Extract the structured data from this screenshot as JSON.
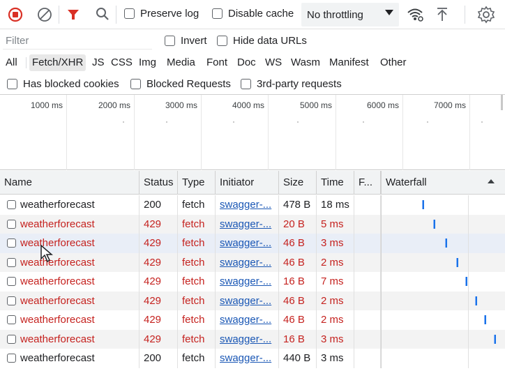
{
  "toolbar": {
    "record_icon": "record-stop-icon",
    "clear_icon": "clear-icon",
    "filter_icon": "filter-funnel-icon",
    "search_icon": "search-icon",
    "preserve_log_label": "Preserve log",
    "disable_cache_label": "Disable cache",
    "throttling_value": "No throttling",
    "colors": {
      "record": "#d93025",
      "filter": "#d93025",
      "error": "#c5221f",
      "link": "#1a57b5",
      "waterfall_bar": "#1a73e8"
    }
  },
  "filter": {
    "placeholder": "Filter",
    "invert_label": "Invert",
    "hide_data_urls_label": "Hide data URLs"
  },
  "types": [
    "All",
    "Fetch/XHR",
    "JS",
    "CSS",
    "Img",
    "Media",
    "Font",
    "Doc",
    "WS",
    "Wasm",
    "Manifest",
    "Other"
  ],
  "active_type": "Fetch/XHR",
  "blocked": {
    "has_blocked_cookies_label": "Has blocked cookies",
    "blocked_requests_label": "Blocked Requests",
    "third_party_label": "3rd-party requests"
  },
  "overview": {
    "ticks": [
      "1000 ms",
      "2000 ms",
      "3000 ms",
      "4000 ms",
      "5000 ms",
      "6000 ms",
      "7000 ms"
    ]
  },
  "table": {
    "columns": {
      "name": "Name",
      "status": "Status",
      "type": "Type",
      "initiator": "Initiator",
      "size": "Size",
      "time": "Time",
      "fulfilled": "F...",
      "waterfall": "Waterfall"
    },
    "rows": [
      {
        "name": "weatherforecast",
        "status": "200",
        "type": "fetch",
        "initiator": "swagger-...",
        "size": "478 B",
        "time": "18 ms",
        "error": false,
        "wf": 0.4
      },
      {
        "name": "weatherforecast",
        "status": "429",
        "type": "fetch",
        "initiator": "swagger-...",
        "size": "20 B",
        "time": "5 ms",
        "error": true,
        "wf": 0.51
      },
      {
        "name": "weatherforecast",
        "status": "429",
        "type": "fetch",
        "initiator": "swagger-...",
        "size": "46 B",
        "time": "3 ms",
        "error": true,
        "wf": 0.62
      },
      {
        "name": "weatherforecast",
        "status": "429",
        "type": "fetch",
        "initiator": "swagger-...",
        "size": "46 B",
        "time": "2 ms",
        "error": true,
        "wf": 0.73
      },
      {
        "name": "weatherforecast",
        "status": "429",
        "type": "fetch",
        "initiator": "swagger-...",
        "size": "16 B",
        "time": "7 ms",
        "error": true,
        "wf": 0.82
      },
      {
        "name": "weatherforecast",
        "status": "429",
        "type": "fetch",
        "initiator": "swagger-...",
        "size": "46 B",
        "time": "2 ms",
        "error": true,
        "wf": 0.92
      },
      {
        "name": "weatherforecast",
        "status": "429",
        "type": "fetch",
        "initiator": "swagger-...",
        "size": "46 B",
        "time": "2 ms",
        "error": true,
        "wf": 1.01
      },
      {
        "name": "weatherforecast",
        "status": "429",
        "type": "fetch",
        "initiator": "swagger-...",
        "size": "16 B",
        "time": "3 ms",
        "error": true,
        "wf": 1.1
      },
      {
        "name": "weatherforecast",
        "status": "200",
        "type": "fetch",
        "initiator": "swagger-...",
        "size": "440 B",
        "time": "3 ms",
        "error": false,
        "wf": null
      }
    ]
  }
}
